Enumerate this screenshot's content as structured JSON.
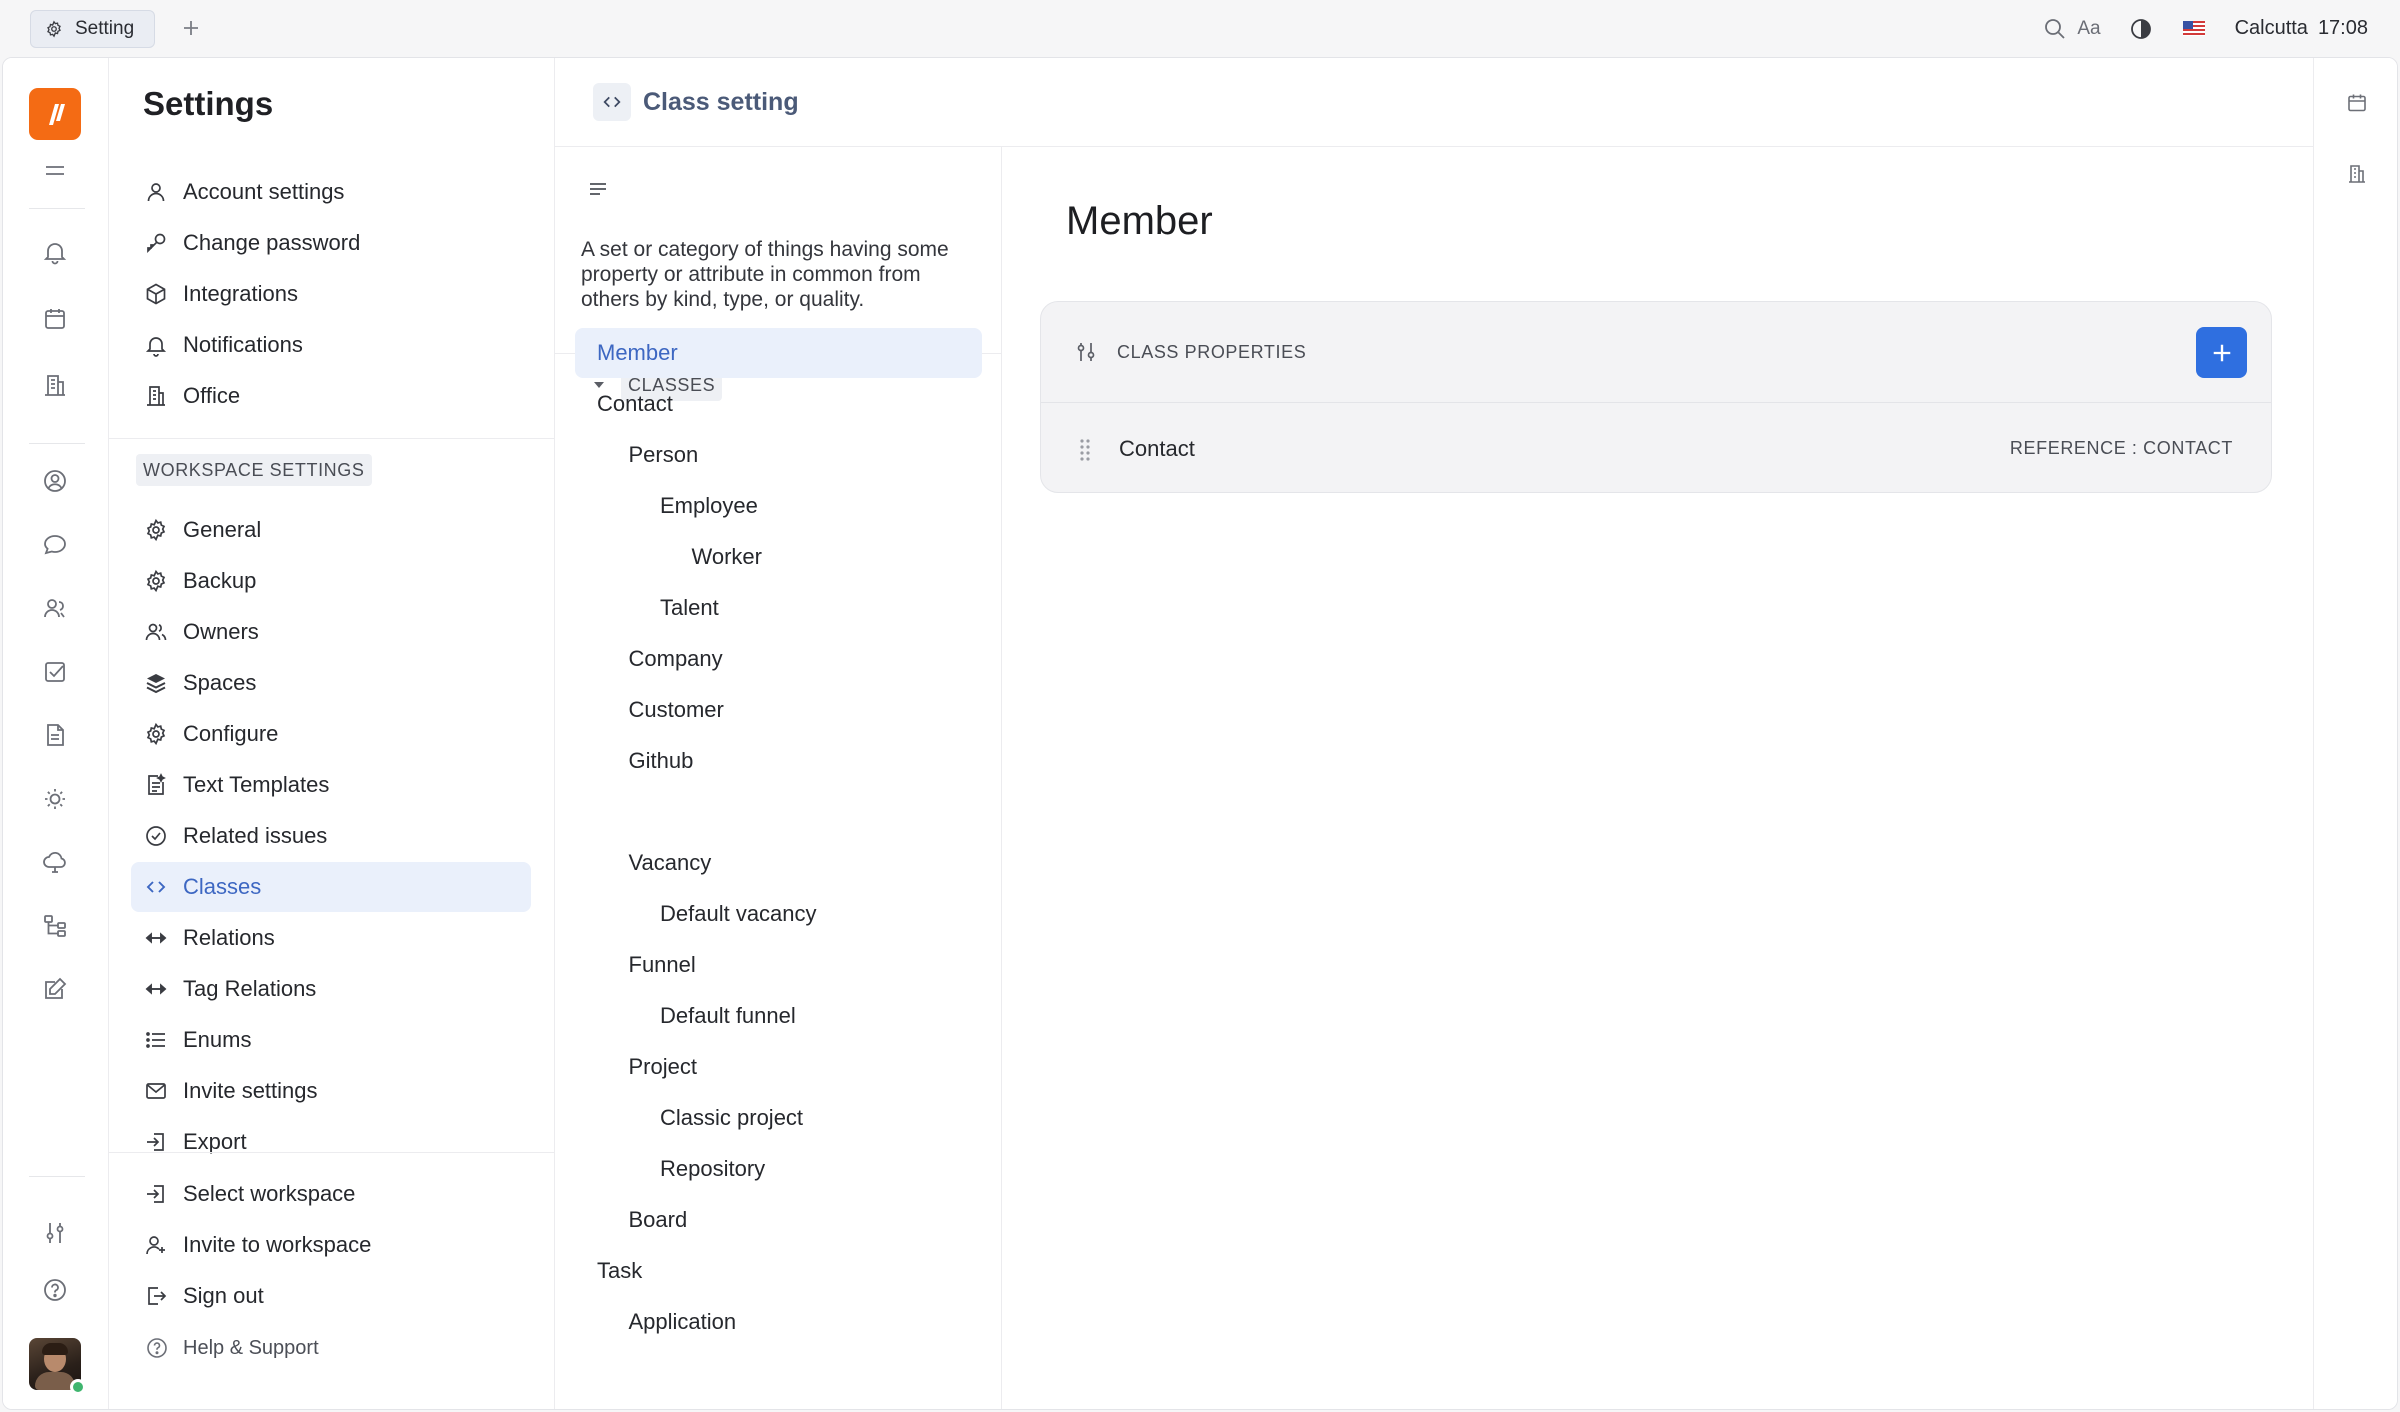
{
  "topbar": {
    "tab_label": "Setting",
    "tab_icon": "gear-icon",
    "add_tab_icon": "plus-icon",
    "font_size_label": "Aa",
    "location": "Calcutta",
    "time": "17:08"
  },
  "settings": {
    "title": "Settings",
    "account_items": [
      {
        "label": "Account settings",
        "icon": "user-icon"
      },
      {
        "label": "Change password",
        "icon": "key-icon"
      },
      {
        "label": "Integrations",
        "icon": "cube-icon"
      },
      {
        "label": "Notifications",
        "icon": "bell-icon"
      },
      {
        "label": "Office",
        "icon": "building-icon"
      }
    ],
    "workspace_label": "WORKSPACE SETTINGS",
    "workspace_items": [
      {
        "label": "General",
        "icon": "gear-icon"
      },
      {
        "label": "Backup",
        "icon": "gear-icon"
      },
      {
        "label": "Owners",
        "icon": "users-icon"
      },
      {
        "label": "Spaces",
        "icon": "layers-icon"
      },
      {
        "label": "Configure",
        "icon": "gear-icon"
      },
      {
        "label": "Text Templates",
        "icon": "template-icon"
      },
      {
        "label": "Related issues",
        "icon": "check-circle-icon"
      },
      {
        "label": "Classes",
        "icon": "code-icon",
        "active": true
      },
      {
        "label": "Relations",
        "icon": "arrows-horizontal-icon"
      },
      {
        "label": "Tag Relations",
        "icon": "arrows-horizontal-icon"
      },
      {
        "label": "Enums",
        "icon": "list-icon"
      },
      {
        "label": "Invite settings",
        "icon": "mail-icon"
      },
      {
        "label": "Export",
        "icon": "export-icon"
      }
    ],
    "footer_items": [
      {
        "label": "Select workspace",
        "icon": "enter-icon"
      },
      {
        "label": "Invite to workspace",
        "icon": "user-plus-icon"
      },
      {
        "label": "Sign out",
        "icon": "sign-out-icon"
      }
    ],
    "help_label": "Help & Support"
  },
  "class_setting": {
    "header_title": "Class setting",
    "description": "A set or category of things having some property or attribute in common from others by kind, type, or quality.",
    "classes_label": "CLASSES",
    "tree": [
      {
        "label": "Member",
        "depth": 0,
        "active": true
      },
      {
        "label": "Contact",
        "depth": 0
      },
      {
        "label": "Person",
        "depth": 1
      },
      {
        "label": "Employee",
        "depth": 2
      },
      {
        "label": "Worker",
        "depth": 3
      },
      {
        "label": "Talent",
        "depth": 2
      },
      {
        "label": "Company",
        "depth": 1
      },
      {
        "label": "Customer",
        "depth": 1
      },
      {
        "label": "Github",
        "depth": 1
      },
      {
        "label": "",
        "depth": 1
      },
      {
        "label": "Vacancy",
        "depth": 1
      },
      {
        "label": "Default vacancy",
        "depth": 2
      },
      {
        "label": "Funnel",
        "depth": 1
      },
      {
        "label": "Default funnel",
        "depth": 2
      },
      {
        "label": "Project",
        "depth": 1
      },
      {
        "label": "Classic project",
        "depth": 2
      },
      {
        "label": "Repository",
        "depth": 2
      },
      {
        "label": "Board",
        "depth": 1
      },
      {
        "label": "Task",
        "depth": 0
      },
      {
        "label": "Application",
        "depth": 1
      }
    ]
  },
  "content": {
    "title": "Member",
    "properties_label": "CLASS PROPERTIES",
    "properties": [
      {
        "name": "Contact",
        "type": "REFERENCE : CONTACT"
      }
    ]
  },
  "colors": {
    "accent": "#3d67c2",
    "active_bg": "#eaf0fb",
    "brand": "#f46b14",
    "add_button": "#2f6fe0"
  }
}
